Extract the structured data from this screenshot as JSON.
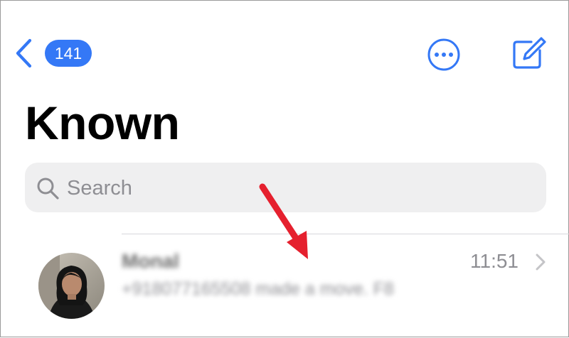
{
  "nav": {
    "back_icon": "chevron-left-icon",
    "badge_count": "141",
    "more_icon": "ellipsis-circle-icon",
    "compose_icon": "compose-icon"
  },
  "header": {
    "title": "Known"
  },
  "search": {
    "placeholder": "Search",
    "icon": "magnifying-glass-icon"
  },
  "messages": [
    {
      "sender": "Monal",
      "preview": "+918077165508 made a move. F8",
      "time": "11:51",
      "chevron_icon": "chevron-right-icon"
    }
  ],
  "colors": {
    "accent": "#3478f6",
    "annotation_arrow": "#e5202e",
    "search_bg": "#efeff0",
    "secondary_text": "#8e8e93"
  }
}
